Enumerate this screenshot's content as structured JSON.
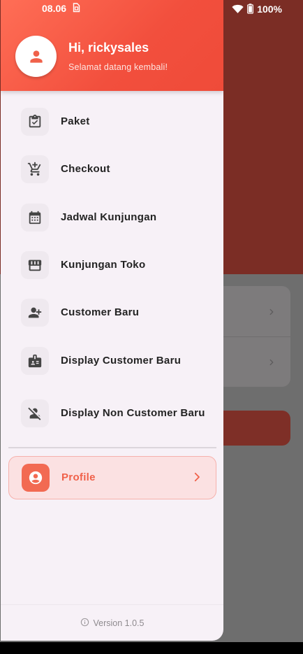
{
  "status_bar": {
    "time": "08.06",
    "battery": "100%"
  },
  "drawer": {
    "greeting": "Hi, rickysales",
    "welcome": "Selamat datang kembali!",
    "menu": [
      {
        "label": "Paket",
        "icon": "clipboard-check-icon"
      },
      {
        "label": "Checkout",
        "icon": "cart-add-icon"
      },
      {
        "label": "Jadwal Kunjungan",
        "icon": "calendar-icon"
      },
      {
        "label": "Kunjungan Toko",
        "icon": "store-icon"
      },
      {
        "label": "Customer Baru",
        "icon": "person-add-icon"
      },
      {
        "label": "Display Customer Baru",
        "icon": "badge-icon"
      },
      {
        "label": "Display Non Customer Baru",
        "icon": "person-off-icon"
      }
    ],
    "profile": {
      "label": "Profile",
      "icon": "account-circle-icon"
    },
    "version": "Version 1.0.5"
  },
  "colors": {
    "accent": "#f0614a",
    "header_gradient_start": "#ff6e56",
    "header_gradient_end": "#ef4b39",
    "drawer_bg": "#f7f1f7",
    "scrim_bg": "#6e6e6e"
  }
}
